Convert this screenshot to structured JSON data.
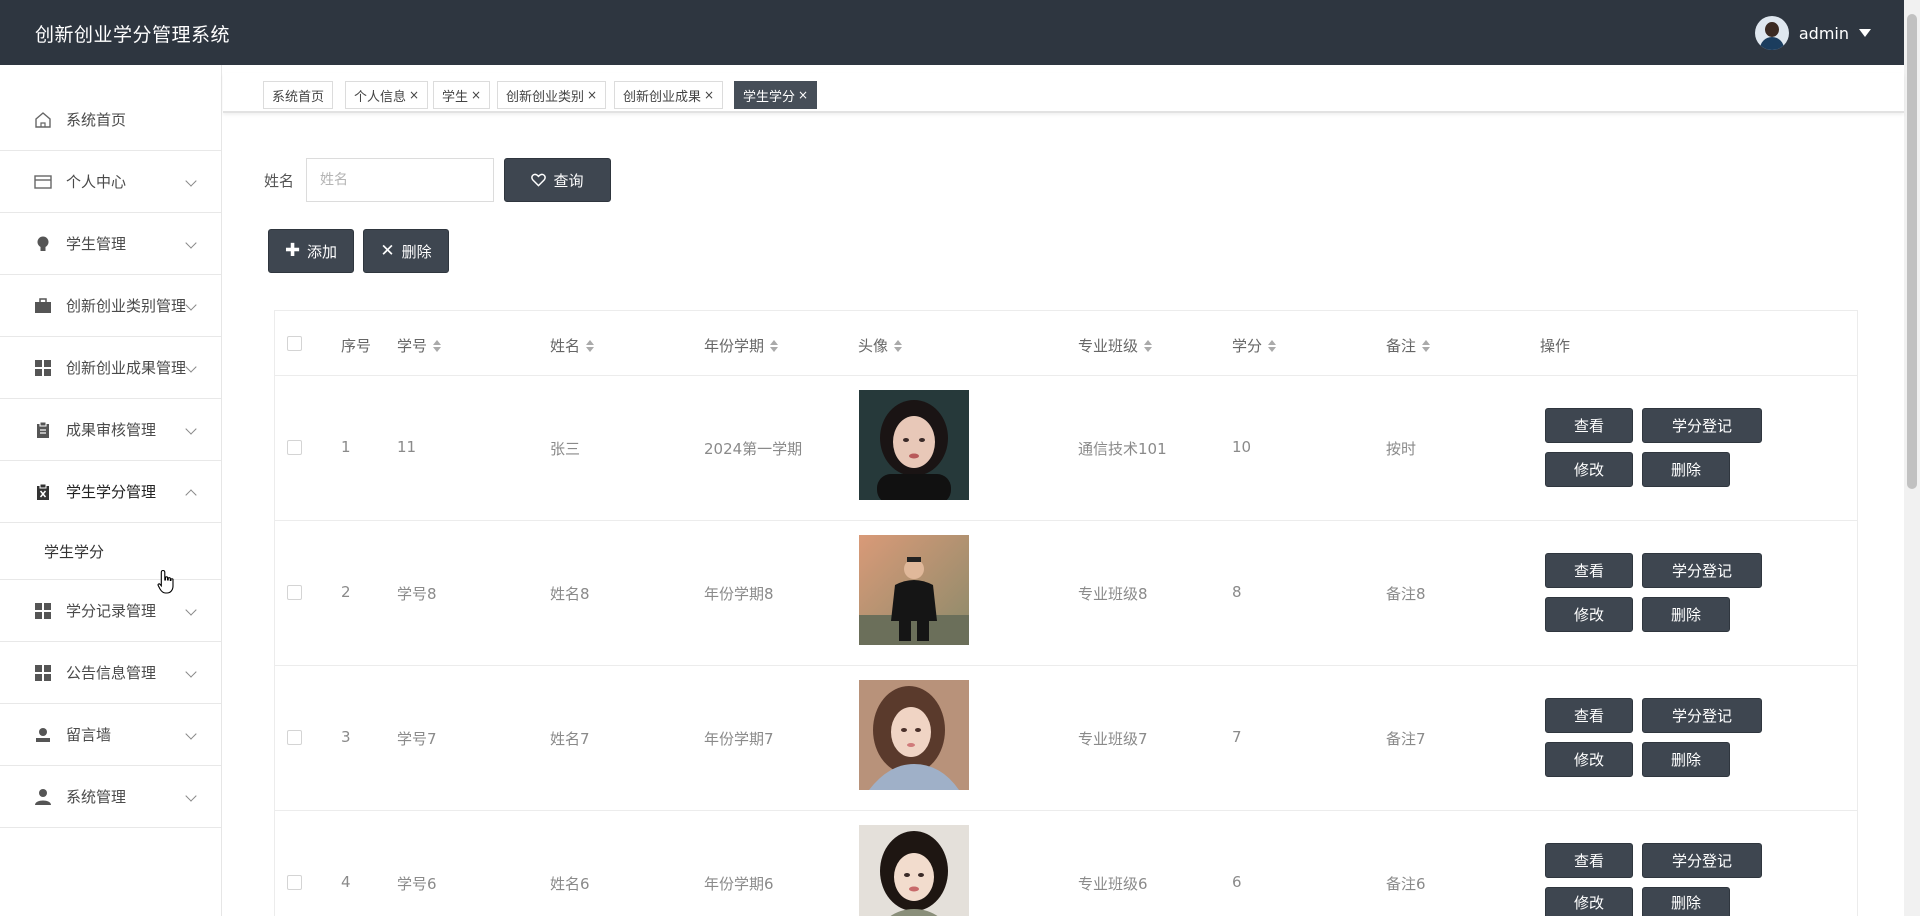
{
  "header": {
    "brand": "创新创业学分管理系统",
    "username": "admin"
  },
  "sidebar": {
    "items": [
      {
        "label": "系统首页",
        "icon": "home-icon"
      },
      {
        "label": "个人中心",
        "icon": "card-icon"
      },
      {
        "label": "学生管理",
        "icon": "bulb-icon"
      },
      {
        "label": "创新创业类别管理",
        "icon": "briefcase-icon"
      },
      {
        "label": "创新创业成果管理",
        "icon": "grid-icon"
      },
      {
        "label": "成果审核管理",
        "icon": "clipboard-icon"
      },
      {
        "label": "学生学分管理",
        "icon": "clipboard-x-icon"
      },
      {
        "label": "学分记录管理",
        "icon": "grid-icon"
      },
      {
        "label": "公告信息管理",
        "icon": "grid-icon"
      },
      {
        "label": "留言墙",
        "icon": "user-icon"
      },
      {
        "label": "系统管理",
        "icon": "person-icon"
      }
    ],
    "submenu": {
      "label": "学生学分"
    }
  },
  "tabs": [
    {
      "label": "系统首页",
      "closable": false
    },
    {
      "label": "个人信息",
      "closable": true
    },
    {
      "label": "学生",
      "closable": true
    },
    {
      "label": "创新创业类别",
      "closable": true
    },
    {
      "label": "创新创业成果",
      "closable": true
    },
    {
      "label": "学生学分",
      "closable": true,
      "active": true
    }
  ],
  "search": {
    "label": "姓名",
    "placeholder": "姓名",
    "value": "",
    "button": "查询"
  },
  "actions": {
    "add": "添加",
    "delete": "删除"
  },
  "table": {
    "columns": [
      "序号",
      "学号",
      "姓名",
      "年份学期",
      "头像",
      "专业班级",
      "学分",
      "备注",
      "操作"
    ],
    "row_buttons": {
      "view": "查看",
      "register": "学分登记",
      "edit": "修改",
      "delete": "删除"
    },
    "rows": [
      {
        "index": "1",
        "student_no": "11",
        "name": "张三",
        "term": "2024第一学期",
        "class": "通信技术101",
        "credits": "10",
        "note": "按时"
      },
      {
        "index": "2",
        "student_no": "学号8",
        "name": "姓名8",
        "term": "年份学期8",
        "class": "专业班级8",
        "credits": "8",
        "note": "备注8"
      },
      {
        "index": "3",
        "student_no": "学号7",
        "name": "姓名7",
        "term": "年份学期7",
        "class": "专业班级7",
        "credits": "7",
        "note": "备注7"
      },
      {
        "index": "4",
        "student_no": "学号6",
        "name": "姓名6",
        "term": "年份学期6",
        "class": "专业班级6",
        "credits": "6",
        "note": "备注6"
      }
    ]
  },
  "colors": {
    "header_bg": "#2e3640",
    "button_bg": "#3e4650",
    "active_tab_bg": "#464e58"
  }
}
